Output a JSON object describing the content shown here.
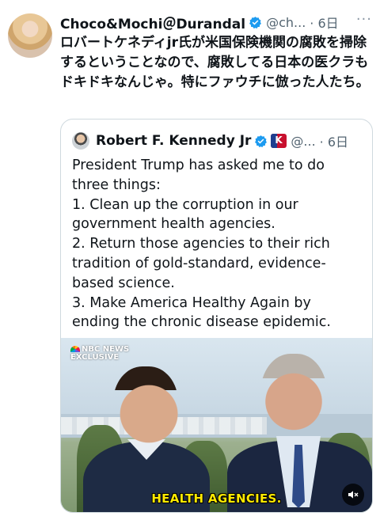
{
  "tweet": {
    "display_name": "Choco&Mochi＠Durandal",
    "handle": "@ch...",
    "time": "· 6日",
    "more_label": "···",
    "text": "ロバートケネディjr氏が米国保険機関の腐敗を掃除するということなので、腐敗してる日本の医クラもドキドキなんじゃ。特にファウチに倣った人たち。"
  },
  "quote": {
    "display_name": "Robert F. Kennedy Jr",
    "flag_label": "K",
    "handle": "@...",
    "time": "· 6日",
    "lines": [
      "President Trump has asked me to do",
      "three things:",
      "1. Clean up the corruption in our",
      "government health agencies.",
      "2. Return those agencies to their rich",
      "tradition of gold-standard, evidence-",
      "based science.",
      "3. Make America Healthy Again by",
      "ending the chronic disease epidemic."
    ]
  },
  "video": {
    "brand_line1": "NBC NEWS",
    "brand_line2": "EXCLUSIVE",
    "caption": "HEALTH AGENCIES.",
    "mute_icon": "speaker-muted-icon"
  },
  "colors": {
    "verified": "#1d9bf0",
    "secondary_text": "#536471",
    "border": "#cfd9de",
    "caption": "#ffe900"
  }
}
